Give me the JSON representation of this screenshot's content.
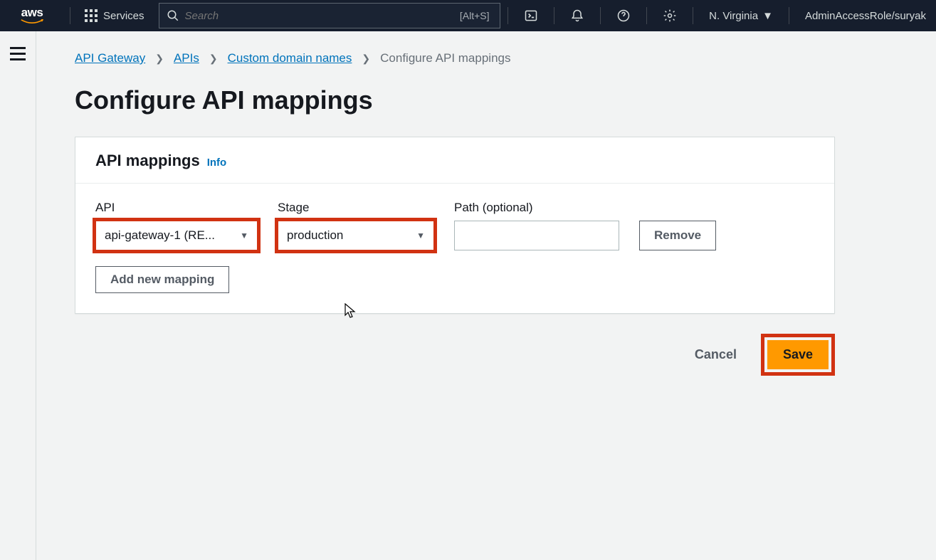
{
  "nav": {
    "services_label": "Services",
    "search_placeholder": "Search",
    "search_hint": "[Alt+S]",
    "region": "N. Virginia",
    "user": "AdminAccessRole/suryak"
  },
  "breadcrumb": {
    "items": [
      "API Gateway",
      "APIs",
      "Custom domain names"
    ],
    "current": "Configure API mappings"
  },
  "page": {
    "title": "Configure API mappings"
  },
  "panel": {
    "title": "API mappings",
    "info_label": "Info",
    "columns": {
      "api": "API",
      "stage": "Stage",
      "path": "Path (optional)"
    },
    "row": {
      "api_value": "api-gateway-1 (RE...",
      "stage_value": "production",
      "path_value": ""
    },
    "remove_label": "Remove",
    "add_label": "Add new mapping"
  },
  "actions": {
    "cancel": "Cancel",
    "save": "Save"
  },
  "highlight_color": "#d13212",
  "accent_color": "#ff9900"
}
